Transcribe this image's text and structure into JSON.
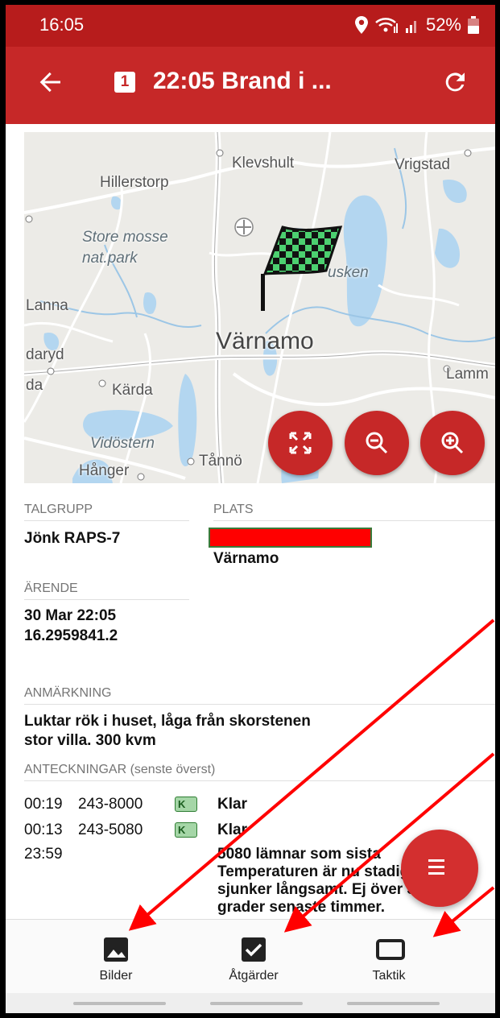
{
  "status": {
    "time": "16:05",
    "battery": "52%"
  },
  "appbar": {
    "badge": "1",
    "title": "22:05 Brand i ..."
  },
  "map": {
    "labels": {
      "klevshult": "Klevshult",
      "vrigstad": "Vrigstad",
      "hillerstorp": "Hillerstorp",
      "store_mosse": "Store mosse",
      "nat_park": "nat.park",
      "lanna": "Lanna",
      "usken": "usken",
      "varnamo": "Värnamo",
      "daryd": "daryd",
      "da": "da",
      "karda": "Kärda",
      "lamm": "Lamm",
      "vidostern": "Vidöstern",
      "hanger": "Hånger",
      "tanno": "Tånnö"
    }
  },
  "details": {
    "talgrupp_caption": "TALGRUPP",
    "talgrupp_value": "Jönk RAPS-7",
    "plats_caption": "PLATS",
    "plats_city": "Värnamo",
    "arende_caption": "ÄRENDE",
    "arende_date": "30 Mar  22:05",
    "arende_number": "16.2959841.2",
    "anmarkning_caption": "ANMÄRKNING",
    "anmarkning_line1": "Luktar rök i huset, låga från skorstenen",
    "anmarkning_line2": "stor villa. 300 kvm",
    "anteckningar_caption": "ANTECKNINGAR (senste överst)"
  },
  "notes": [
    {
      "time": "00:19",
      "unit": "243-8000",
      "tag": "K",
      "text": "Klar"
    },
    {
      "time": "00:13",
      "unit": "243-5080",
      "tag": "K",
      "text": "Klar"
    },
    {
      "time": "23:59",
      "unit": "",
      "tag": "",
      "lines": [
        "5080 lämnar som sista",
        "Temperaturen är nu stadigt",
        "sjunker långsamt. Ej över 31",
        "grader senaste timmer."
      ]
    }
  ],
  "bottom_nav": [
    {
      "label": "Bilder",
      "icon": "image-icon"
    },
    {
      "label": "Åtgärder",
      "icon": "checkbox-icon"
    },
    {
      "label": "Taktik",
      "icon": "rectangle-icon"
    }
  ],
  "colors": {
    "appbar": "#c62828",
    "statusbar": "#b71c1c",
    "accent": "#d32f2f",
    "annotation_arrow": "#ff0000"
  }
}
